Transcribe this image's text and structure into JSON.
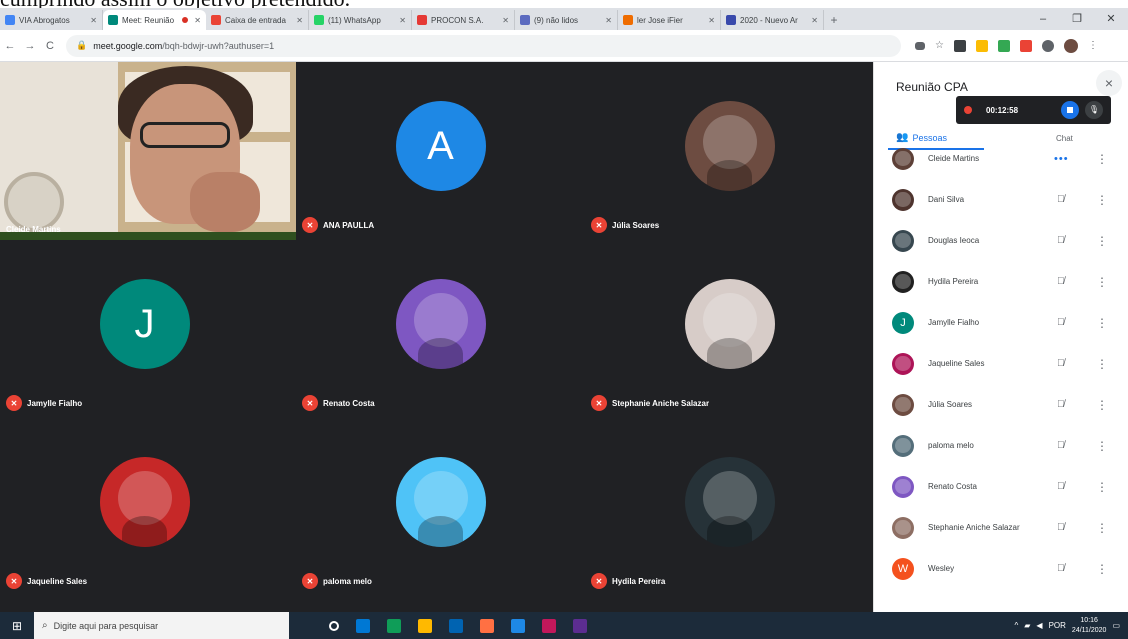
{
  "caption": "cumprindo assim o objetivo pretendido.",
  "browser": {
    "tabs": [
      {
        "title": "VIA Abrogatos",
        "color": "#4285f4",
        "active": false
      },
      {
        "title": "Meet: Reunião",
        "color": "#00897b",
        "active": true
      },
      {
        "title": "Caixa de entrada",
        "color": "#ea4335",
        "active": false
      },
      {
        "title": "(11) WhatsApp",
        "color": "#25d366",
        "active": false
      },
      {
        "title": "PROCON S.A.",
        "color": "#e53935",
        "active": false
      },
      {
        "title": "(9) não lidos",
        "color": "#5c6bc0",
        "active": false
      },
      {
        "title": "ler Jose iFier",
        "color": "#ef6c00",
        "active": false
      },
      {
        "title": "2020 - Nuevo Ar",
        "color": "#3949ab",
        "active": false
      }
    ],
    "new_tab": "+",
    "url_host": "meet.google.com",
    "url_path": "/bqh-bdwjr-uwh?authuser=1",
    "lock_icon": "lock-icon",
    "window_controls": [
      "–",
      "❐",
      "✕"
    ],
    "nav": [
      "←",
      "→",
      "C"
    ]
  },
  "meet": {
    "self_name": "Cleide Martins",
    "tiles": [
      {
        "name": "ANA PAULLA",
        "initial": "A",
        "color": "#1e88e5",
        "photo": false
      },
      {
        "name": "Júlia Soares",
        "initial": "",
        "color": "#6d4c41",
        "photo": true
      },
      {
        "name": "Jamylle Fialho",
        "initial": "J",
        "color": "#00897b",
        "photo": false
      },
      {
        "name": "Renato Costa",
        "initial": "",
        "color": "#7e57c2",
        "photo": true
      },
      {
        "name": "Stephanie Aniche Salazar",
        "initial": "",
        "color": "#d7ccc8",
        "photo": true
      },
      {
        "name": "Jaqueline Sales",
        "initial": "",
        "color": "#c62828",
        "photo": true
      },
      {
        "name": "paloma melo",
        "initial": "",
        "color": "#4fc3f7",
        "photo": true
      },
      {
        "name": "Hydila Pereira",
        "initial": "",
        "color": "#263238",
        "photo": true
      }
    ]
  },
  "panel": {
    "title": "Reunião CPA",
    "close": "×",
    "rec_time": "00:12:58",
    "tab_people": "Pessoas",
    "tab_chat": "Chat",
    "participants": [
      {
        "name": "Cleide Martins",
        "color": "#5d4037",
        "initial": "",
        "speaking": true
      },
      {
        "name": "Dani Silva",
        "color": "#4e342e",
        "initial": "",
        "speaking": false
      },
      {
        "name": "Douglas Ieoca",
        "color": "#37474f",
        "initial": "",
        "speaking": false
      },
      {
        "name": "Hydila Pereira",
        "color": "#212121",
        "initial": "",
        "speaking": false
      },
      {
        "name": "Jamylle Fialho",
        "color": "#00897b",
        "initial": "J",
        "speaking": false
      },
      {
        "name": "Jaqueline Sales",
        "color": "#ad1457",
        "initial": "",
        "speaking": false
      },
      {
        "name": "Júlia Soares",
        "color": "#6d4c41",
        "initial": "",
        "speaking": false
      },
      {
        "name": "paloma melo",
        "color": "#546e7a",
        "initial": "",
        "speaking": false
      },
      {
        "name": "Renato Costa",
        "color": "#7e57c2",
        "initial": "",
        "speaking": false
      },
      {
        "name": "Stephanie Aniche Salazar",
        "color": "#8d6e63",
        "initial": "",
        "speaking": false
      },
      {
        "name": "Wesley",
        "color": "#f4511e",
        "initial": "W",
        "speaking": false
      }
    ]
  },
  "taskbar": {
    "search_placeholder": "Digite aqui para pesquisar",
    "apps": [
      "#ffffff",
      "#0078d4",
      "#0f9d58",
      "#ffb900",
      "#0063b1",
      "#ff7043",
      "#1e88e5",
      "#c2185b",
      "#5c2d91"
    ],
    "lang": "POR",
    "time": "10:16",
    "date": "24/11/2020"
  }
}
